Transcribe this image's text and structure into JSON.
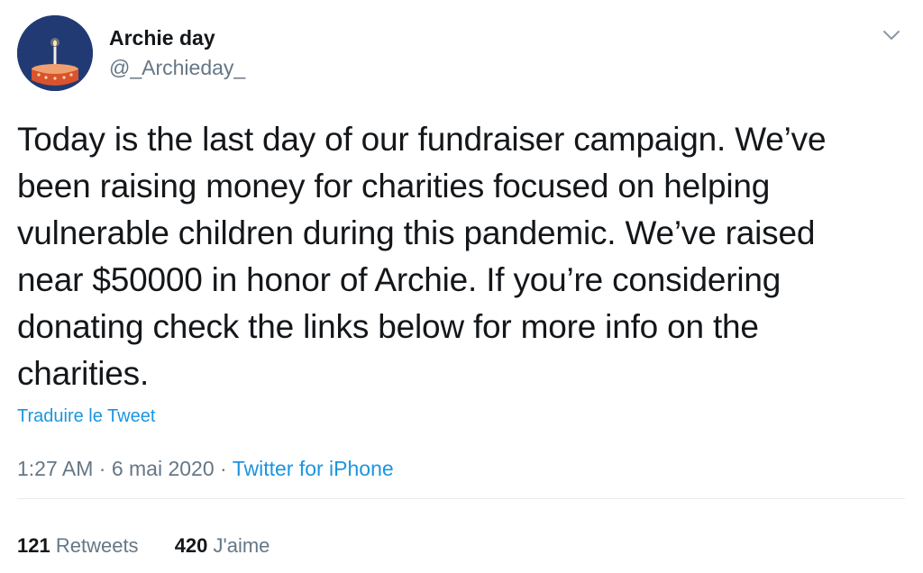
{
  "author": {
    "display_name": "Archie day",
    "handle": "@_Archieday_"
  },
  "tweet": {
    "lines": [
      "Today is the last day of our fundraiser campaign. We’ve",
      "been raising money for charities focused on helping",
      "vulnerable children during this pandemic. We’ve raised",
      "near $50000 in honor of Archie. If you’re considering",
      "donating check the links below for more info on the",
      "charities."
    ],
    "translate_label": "Traduire le Tweet",
    "time": "1:27 AM",
    "date": "6 mai 2020",
    "separator": "·",
    "source": "Twitter for iPhone"
  },
  "stats": {
    "retweets_count": "121",
    "retweets_label": "Retweets",
    "likes_count": "420",
    "likes_label": "J'aime"
  },
  "icons": {
    "avatar": "birthday-cake-candle-avatar",
    "menu": "chevron-down-icon"
  },
  "colors": {
    "link_blue": "#1b95e0",
    "secondary_text": "#657786",
    "primary_text": "#14171a",
    "avatar_bg": "#223a73",
    "cake": "#d8532e",
    "divider": "#e6ecf0"
  }
}
